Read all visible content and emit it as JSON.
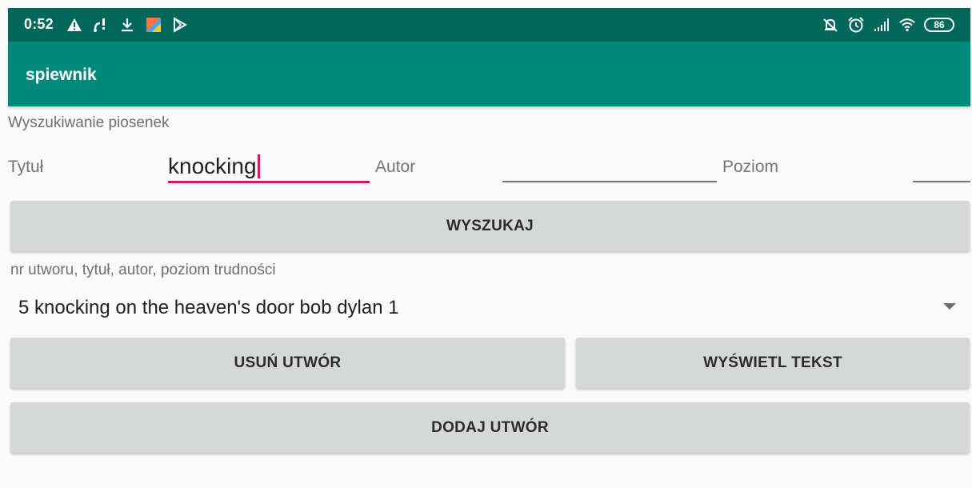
{
  "status_bar": {
    "time": "0:52",
    "battery": "86",
    "left_icons": [
      "warning-icon",
      "usb-debug-icon",
      "download-icon",
      "app-notification-icon",
      "play-store-icon"
    ],
    "right_icons": [
      "mute-icon",
      "alarm-icon",
      "signal-icon",
      "wifi-icon",
      "battery-icon"
    ]
  },
  "app_bar": {
    "title": "spiewnik"
  },
  "search": {
    "heading": "Wyszukiwanie piosenek",
    "title_label": "Tytuł",
    "title_value": "knocking",
    "author_label": "Autor",
    "author_value": "",
    "level_label": "Poziom",
    "level_value": "",
    "search_button": "WYSZUKAJ"
  },
  "results": {
    "hint": "nr utworu, tytuł, autor, poziom trudności",
    "selected": "5 knocking on the heaven's door bob dylan 1"
  },
  "actions": {
    "delete_button": "USUŃ UTWÓR",
    "show_text_button": "WYŚWIETL TEKST",
    "add_button": "DODAJ UTWÓR"
  },
  "colors": {
    "status_bar": "#00675a",
    "app_bar": "#00897b",
    "accent": "#d81b60",
    "button": "#d6d7d7",
    "background": "#fafafa"
  }
}
